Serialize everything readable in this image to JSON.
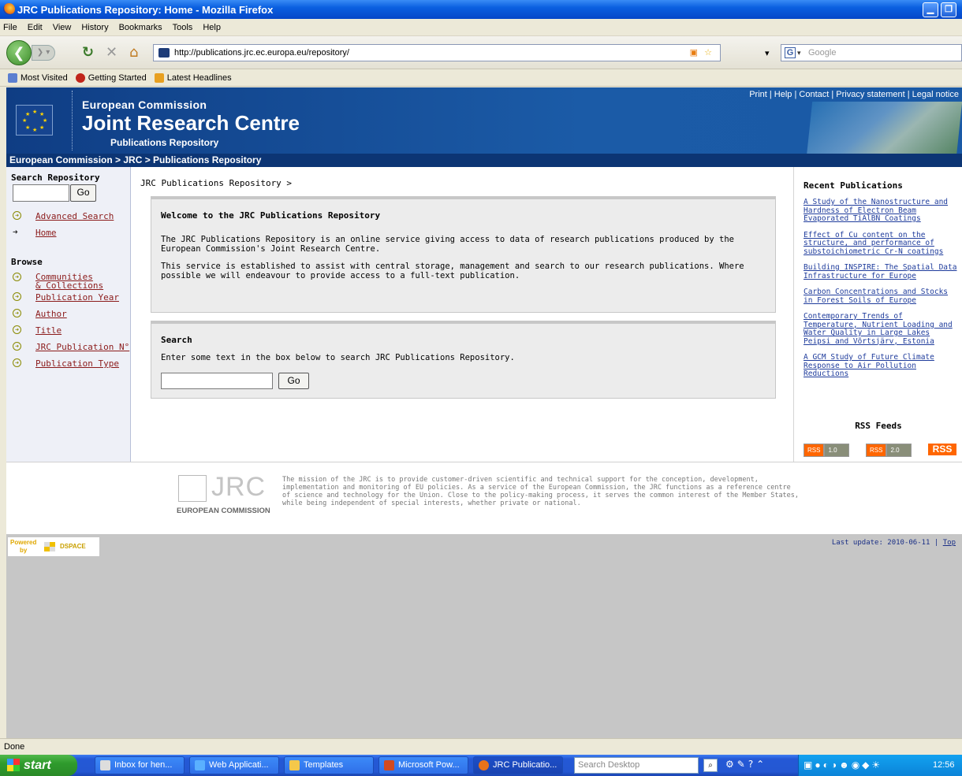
{
  "window": {
    "title": "JRC Publications Repository: Home - Mozilla Firefox"
  },
  "menu": [
    "File",
    "Edit",
    "View",
    "History",
    "Bookmarks",
    "Tools",
    "Help"
  ],
  "url": "http://publications.jrc.ec.europa.eu/repository/",
  "search_engine": {
    "label": "G",
    "placeholder": "Google"
  },
  "bookmarks": [
    "Most Visited",
    "Getting Started",
    "Latest Headlines"
  ],
  "banner": {
    "top_links": "Print | Help | Contact | Privacy statement | Legal notice",
    "line1": "European Commission",
    "line2": "Joint Research Centre",
    "line3": "Publications Repository",
    "breadcrumb": "European Commission  > JRC  > Publications Repository"
  },
  "left": {
    "search_heading": "Search Repository",
    "go": "Go",
    "advanced": "Advanced Search",
    "home": "Home",
    "browse_heading": "Browse",
    "browse": [
      "Communities",
      "& Collections",
      "Publication Year",
      "Author",
      "Title",
      "JRC Publication N°",
      "Publication Type"
    ]
  },
  "main": {
    "crumb": "JRC Publications Repository >",
    "welcome_title": "Welcome to the JRC Publications Repository",
    "welcome_p1": "The JRC Publications Repository is an online service giving access to data of research publications produced by the European Commission's Joint Research Centre.",
    "welcome_p2": "This service is established to assist with central storage, management and search to our research publications. Where possible we will endeavour to provide access to a full-text publication.",
    "search_title": "Search",
    "search_text": "Enter some text in the box below to search JRC Publications Repository.",
    "go": "Go"
  },
  "right": {
    "heading": "Recent Publications",
    "pubs": [
      "A Study of the Nanostructure and Hardness of Electron Beam Evaporated TiAlBN Coatings",
      "Effect of Cu content on the structure, and performance of substoichiometric Cr-N coatings",
      "Building INSPIRE: The Spatial Data Infrastructure for Europe",
      "Carbon Concentrations and Stocks in Forest Soils of Europe",
      "Contemporary Trends of Temperature, Nutrient Loading and Water Quality in Large Lakes Peipsi and Võrtsjärv, Estonia",
      "A GCM Study of Future Climate Response to Air Pollution Reductions"
    ],
    "rss_heading": "RSS Feeds",
    "rss1": "RSS",
    "rss1v": "1.0",
    "rss2": "RSS",
    "rss2v": "2.0",
    "rss3": "RSS"
  },
  "footer": {
    "logo_text": "JRC",
    "ec": "EUROPEAN COMMISSION",
    "mission": "The mission of the JRC is to provide customer-driven scientific and technical support for the conception, development, implementation and monitoring of EU policies. As a service of the European Commission, the JRC functions as a reference centre of science and technology for the Union. Close to the policy-making process, it serves the common interest of the Member States, while being independent of special interests, whether private or national.",
    "powered": "Powered",
    "by": "by",
    "dspace": "DSPACE",
    "last_update": "Last update: 2010-06-11 |",
    "top": "Top"
  },
  "status": "Done",
  "taskbar": {
    "start": "start",
    "items": [
      "Inbox for hen...",
      "Web Applicati...",
      "Templates",
      "Microsoft Pow...",
      "JRC Publicatio..."
    ],
    "search_placeholder": "Search Desktop",
    "clock": "12:56 PM"
  }
}
